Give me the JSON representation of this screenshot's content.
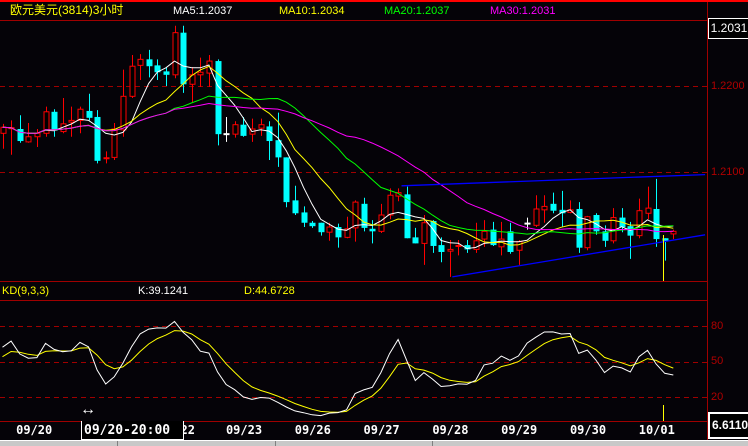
{
  "header": {
    "title": "欧元美元(3814)3小时",
    "ma5": "MA5:1.2037",
    "ma10": "MA10:1.2034",
    "ma20": "MA20:1.2037",
    "ma30": "MA30:1.2031",
    "current_price": "1.2031"
  },
  "indicator": {
    "name": "KD(9,3,3)",
    "k": "K:39.1241",
    "d": "D:44.6728",
    "current_value": "6.6110"
  },
  "tooltip": {
    "time": "09/20-20:00"
  },
  "colors": {
    "up": "#ff0000",
    "down": "#00ffff",
    "flat": "#ffffff",
    "ma5": "#ffffff",
    "ma10": "#ffff00",
    "ma20": "#00ff00",
    "ma30": "#ff00ff",
    "trendline": "#0000ff",
    "k": "#ffffff",
    "d": "#ffff00",
    "grid": "#a00000"
  },
  "chart_data": {
    "type": "candlestick",
    "title": "欧元美元(3814)3小时",
    "price_axis": {
      "ticks": [
        "1.2200",
        "1.2100"
      ],
      "tick_values": [
        1.22,
        1.21
      ]
    },
    "kd_axis": {
      "ticks": [
        "80",
        "50",
        "20"
      ],
      "tick_values": [
        80,
        50,
        20
      ],
      "range": [
        0,
        100
      ]
    },
    "x_labels": [
      {
        "label": "09/20",
        "index": 6
      },
      {
        "label": "09/22",
        "index": 22.6
      },
      {
        "label": "09/23",
        "index": 30.4
      },
      {
        "label": "09/26",
        "index": 38.4
      },
      {
        "label": "09/27",
        "index": 46.4
      },
      {
        "label": "09/28",
        "index": 54.4
      },
      {
        "label": "09/29",
        "index": 62.4
      },
      {
        "label": "09/30",
        "index": 70.4
      },
      {
        "label": "10/01",
        "index": 78.4
      }
    ],
    "ma_periods": [
      5,
      10,
      20,
      30
    ],
    "kd_params": [
      9,
      3,
      3
    ],
    "ohlc": [
      [
        1.2145,
        1.2156,
        1.2127,
        1.2152
      ],
      [
        1.215,
        1.216,
        1.212,
        1.2151
      ],
      [
        1.215,
        1.2166,
        1.2134,
        1.2136
      ],
      [
        1.2135,
        1.2157,
        1.2134,
        1.2141
      ],
      [
        1.2141,
        1.215,
        1.2129,
        1.2145
      ],
      [
        1.2145,
        1.2176,
        1.2141,
        1.217
      ],
      [
        1.217,
        1.2173,
        1.2141,
        1.2148
      ],
      [
        1.2147,
        1.2186,
        1.2145,
        1.2156
      ],
      [
        1.2158,
        1.2176,
        1.2141,
        1.216
      ],
      [
        1.216,
        1.2176,
        1.2145,
        1.2173
      ],
      [
        1.2171,
        1.2191,
        1.216,
        1.2163
      ],
      [
        1.2164,
        1.2172,
        1.211,
        1.2113
      ],
      [
        1.2115,
        1.2124,
        1.211,
        1.2116
      ],
      [
        1.2117,
        1.2157,
        1.2114,
        1.215
      ],
      [
        1.2149,
        1.2219,
        1.2141,
        1.2188
      ],
      [
        1.2188,
        1.2236,
        1.2186,
        1.2223
      ],
      [
        1.2224,
        1.2237,
        1.2207,
        1.2231
      ],
      [
        1.2231,
        1.2242,
        1.221,
        1.2223
      ],
      [
        1.2224,
        1.2231,
        1.2207,
        1.2216
      ],
      [
        1.2217,
        1.2222,
        1.22,
        1.2213
      ],
      [
        1.2213,
        1.227,
        1.2209,
        1.2262
      ],
      [
        1.2262,
        1.227,
        1.2192,
        1.2202
      ],
      [
        1.2202,
        1.2222,
        1.2181,
        1.2213
      ],
      [
        1.2213,
        1.2233,
        1.2199,
        1.2216
      ],
      [
        1.2215,
        1.2236,
        1.2199,
        1.2229
      ],
      [
        1.2229,
        1.2231,
        1.2131,
        1.2144
      ],
      [
        1.2144,
        1.2164,
        1.2135,
        1.2144
      ],
      [
        1.2144,
        1.2159,
        1.214,
        1.2155
      ],
      [
        1.2155,
        1.2164,
        1.2141,
        1.2142
      ],
      [
        1.2144,
        1.2162,
        1.2135,
        1.215
      ],
      [
        1.2151,
        1.2162,
        1.2142,
        1.2155
      ],
      [
        1.2153,
        1.2159,
        1.2114,
        1.2136
      ],
      [
        1.2137,
        1.2169,
        1.2106,
        1.2117
      ],
      [
        1.2117,
        1.2117,
        1.2059,
        1.2065
      ],
      [
        1.2067,
        1.2084,
        1.205,
        1.2052
      ],
      [
        1.2053,
        1.206,
        1.2036,
        1.2041
      ],
      [
        1.2041,
        1.2043,
        1.2035,
        1.2037
      ],
      [
        1.2041,
        1.2041,
        1.2026,
        1.203
      ],
      [
        1.203,
        1.2041,
        1.202,
        1.2036
      ],
      [
        1.2036,
        1.204,
        1.2012,
        1.2024
      ],
      [
        1.2024,
        1.2048,
        1.2023,
        1.2034
      ],
      [
        1.2035,
        1.2067,
        1.2019,
        1.2065
      ],
      [
        1.2063,
        1.207,
        1.2031,
        1.2035
      ],
      [
        1.2034,
        1.2044,
        1.2017,
        1.2031
      ],
      [
        1.2031,
        1.2063,
        1.2029,
        1.205
      ],
      [
        1.205,
        1.2081,
        1.2045,
        1.2073
      ],
      [
        1.2072,
        1.2081,
        1.2066,
        1.2076
      ],
      [
        1.2074,
        1.2083,
        1.2023,
        1.2023
      ],
      [
        1.2024,
        1.2035,
        1.2017,
        1.2017
      ],
      [
        1.2017,
        1.205,
        1.1992,
        1.2041
      ],
      [
        1.2043,
        1.2044,
        1.2006,
        1.2014
      ],
      [
        1.2015,
        1.2024,
        1.1995,
        1.2007
      ],
      [
        1.2008,
        1.2021,
        1.1978,
        1.201
      ],
      [
        1.2013,
        1.2021,
        1.2003,
        1.2014
      ],
      [
        1.2015,
        1.2021,
        1.2006,
        1.201
      ],
      [
        1.201,
        1.2041,
        1.2006,
        1.202
      ],
      [
        1.2022,
        1.2044,
        1.2013,
        1.2031
      ],
      [
        1.2033,
        1.2042,
        1.2014,
        1.2015
      ],
      [
        1.2013,
        1.2042,
        1.2003,
        1.2022
      ],
      [
        1.2031,
        1.2041,
        1.2005,
        1.2007
      ],
      [
        1.2009,
        1.2021,
        1.1992,
        1.2019
      ],
      [
        1.204,
        1.2047,
        1.2033,
        1.204
      ],
      [
        1.2038,
        1.2073,
        1.2036,
        1.2057
      ],
      [
        1.2056,
        1.2073,
        1.2041,
        1.206
      ],
      [
        1.2063,
        1.2076,
        1.2052,
        1.2055
      ],
      [
        1.2056,
        1.2078,
        1.2036,
        1.2052
      ],
      [
        1.2053,
        1.2067,
        1.2052,
        1.2056
      ],
      [
        1.2057,
        1.2065,
        1.2006,
        1.2012
      ],
      [
        1.2012,
        1.2049,
        1.2009,
        1.2048
      ],
      [
        1.205,
        1.2052,
        1.2027,
        1.2031
      ],
      [
        1.2031,
        1.2038,
        1.2013,
        1.202
      ],
      [
        1.202,
        1.2058,
        1.2017,
        1.2047
      ],
      [
        1.2047,
        1.2058,
        1.203,
        1.2036
      ],
      [
        1.2037,
        1.2042,
        1.1999,
        1.2026
      ],
      [
        1.2026,
        1.2069,
        1.2023,
        1.2055
      ],
      [
        1.2052,
        1.2083,
        1.2045,
        1.2058
      ],
      [
        1.2057,
        1.2092,
        1.2013,
        1.2022
      ],
      [
        1.2023,
        1.2023,
        1.1997,
        1.202
      ],
      [
        1.2028,
        1.2033,
        1.2022,
        1.2031
      ]
    ],
    "trendlines": [
      {
        "name": "upper-channel",
        "points": [
          [
            46.4,
            1.2084
          ],
          [
            81.7,
            1.2097
          ]
        ]
      },
      {
        "name": "lower-channel",
        "points": [
          [
            52.3,
            1.1978
          ],
          [
            81.7,
            1.2027
          ]
        ]
      }
    ]
  }
}
